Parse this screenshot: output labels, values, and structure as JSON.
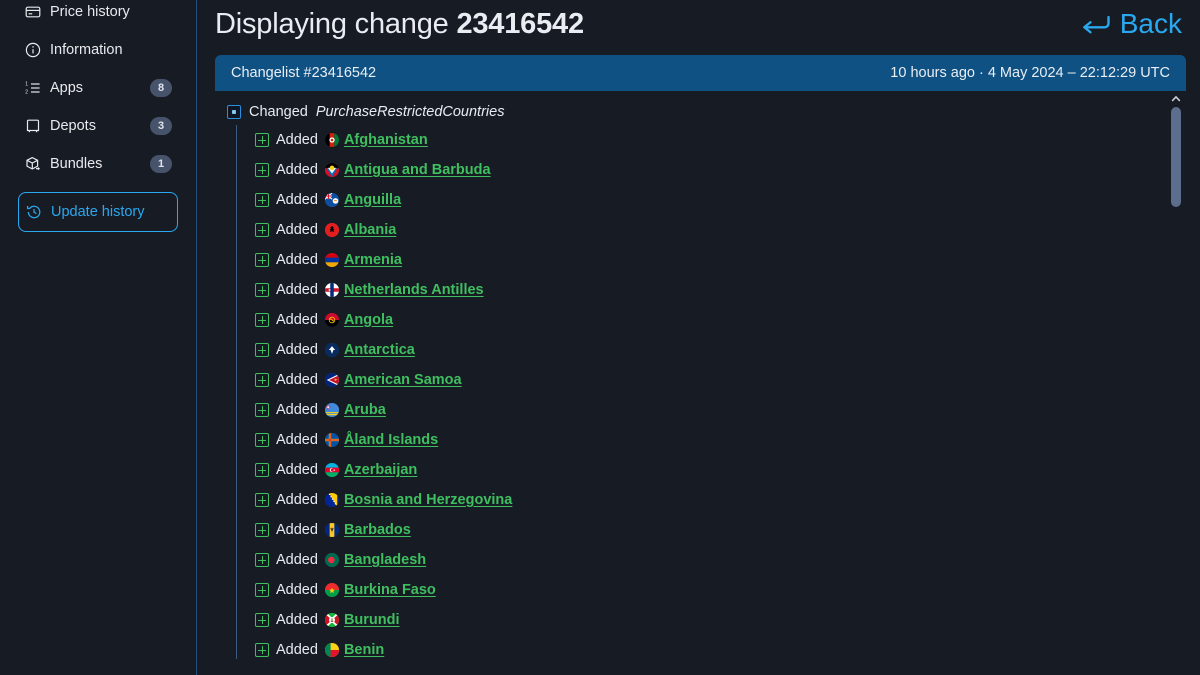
{
  "sidebar": {
    "items": [
      {
        "label": "Price history",
        "icon": "card-icon",
        "badge": null,
        "active": false
      },
      {
        "label": "Information",
        "icon": "info-icon",
        "badge": null,
        "active": false
      },
      {
        "label": "Apps",
        "icon": "ordered-list-icon",
        "badge": "8",
        "active": false
      },
      {
        "label": "Depots",
        "icon": "depot-icon",
        "badge": "3",
        "active": false
      },
      {
        "label": "Bundles",
        "icon": "bundle-box-icon",
        "badge": "1",
        "active": false
      },
      {
        "label": "Update history",
        "icon": "history-clock-icon",
        "badge": null,
        "active": true
      }
    ]
  },
  "header": {
    "title_prefix": "Displaying change ",
    "title_change_id": "23416542",
    "back_label": "Back",
    "back_icon": "arrow-return-left-icon"
  },
  "panel": {
    "title": "Changelist #23416542",
    "timestamp": "10 hours ago · 4 May 2024 – 22:12:29 UTC"
  },
  "change": {
    "verb": "Changed",
    "property": "PurchaseRestrictedCountries",
    "icon": "changed-square-icon",
    "added_label": "Added",
    "added_icon": "plus-square-icon",
    "entries": [
      {
        "name": "Afghanistan",
        "flag": "af"
      },
      {
        "name": "Antigua and Barbuda",
        "flag": "ag"
      },
      {
        "name": "Anguilla",
        "flag": "ai"
      },
      {
        "name": "Albania",
        "flag": "al"
      },
      {
        "name": "Armenia",
        "flag": "am"
      },
      {
        "name": "Netherlands Antilles",
        "flag": "an"
      },
      {
        "name": "Angola",
        "flag": "ao"
      },
      {
        "name": "Antarctica",
        "flag": "aq"
      },
      {
        "name": "American Samoa",
        "flag": "as"
      },
      {
        "name": "Aruba",
        "flag": "aw"
      },
      {
        "name": "Åland Islands",
        "flag": "ax"
      },
      {
        "name": "Azerbaijan",
        "flag": "az"
      },
      {
        "name": "Bosnia and Herzegovina",
        "flag": "ba"
      },
      {
        "name": "Barbados",
        "flag": "bb"
      },
      {
        "name": "Bangladesh",
        "flag": "bd"
      },
      {
        "name": "Burkina Faso",
        "flag": "bf"
      },
      {
        "name": "Burundi",
        "flag": "bi"
      },
      {
        "name": "Benin",
        "flag": "bj"
      }
    ]
  },
  "scrollbar": {
    "up_icon": "chevron-up-icon",
    "thumb_name": "scrollbar-thumb"
  },
  "colors": {
    "background": "#171b24",
    "panel_header": "#105183",
    "accent_blue": "#2aa8ef",
    "added_green": "#3fbf5f",
    "badge_bg": "#46536b"
  }
}
